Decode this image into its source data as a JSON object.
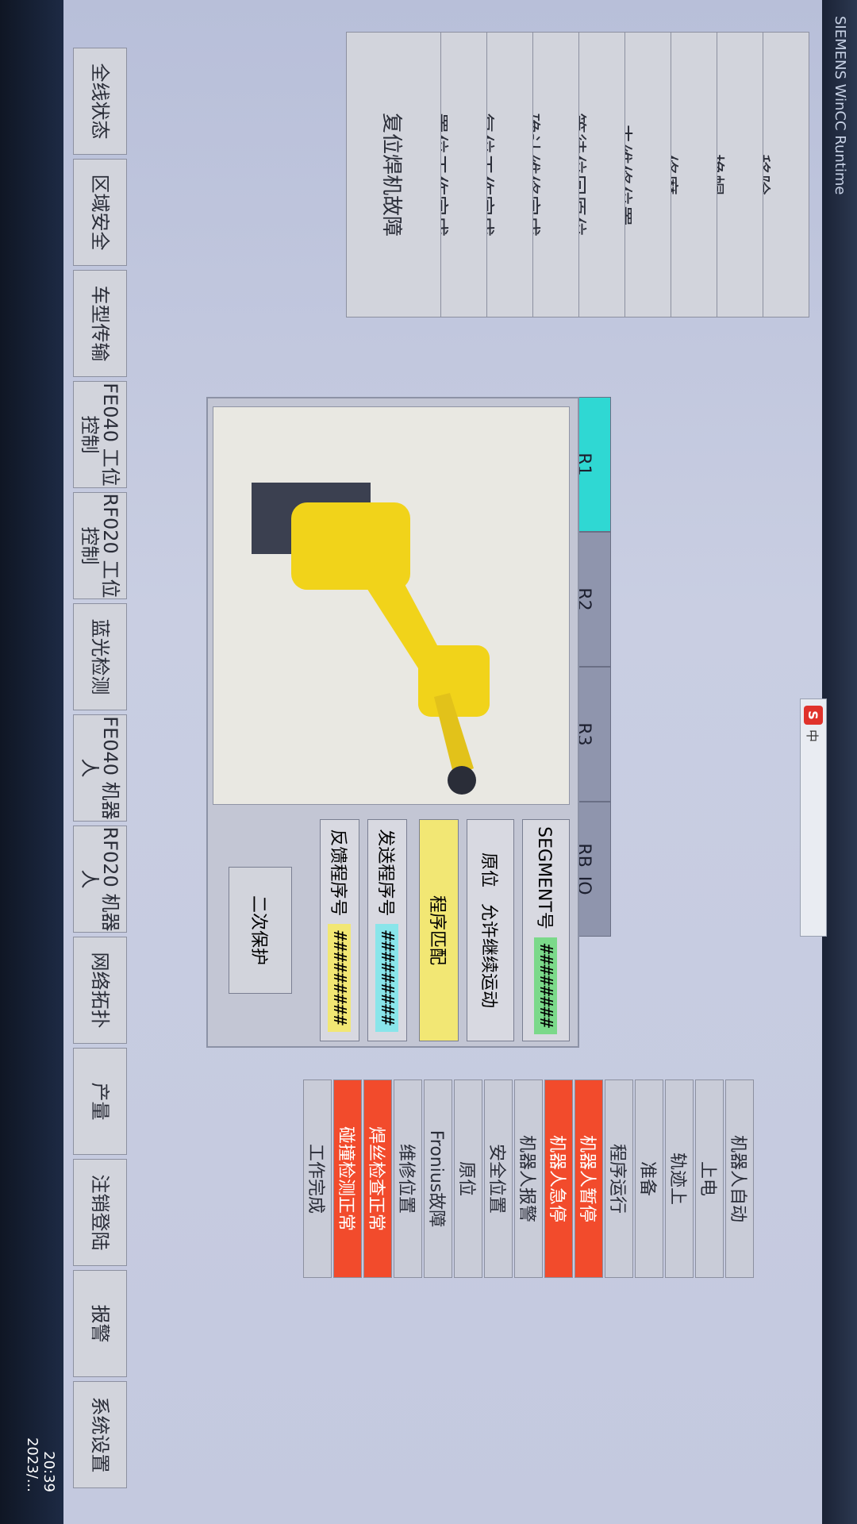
{
  "title": "SIEMENS WinCC Runtime",
  "ime": {
    "logo": "S",
    "label": "中"
  },
  "clock": {
    "time": "20:39",
    "date": "2023/..."
  },
  "left_menu": [
    "移除",
    "换帽",
    "修磨",
    "去维修位置",
    "等待位回原位",
    "确认维修完成",
    "复位工作完成",
    "置位工作完成",
    "复位焊机故障"
  ],
  "robot_tabs": [
    {
      "label": "R1",
      "active": true
    },
    {
      "label": "R2",
      "active": false
    },
    {
      "label": "R3",
      "active": false
    },
    {
      "label": "RB_IO",
      "active": false
    }
  ],
  "info": {
    "segment_label": "SEGMENT号",
    "segment_value": "########",
    "home_label": "原位",
    "allow_continue": "允许继续运动",
    "program_match": "程序匹配",
    "send_prog_label": "发送程序号",
    "send_prog_value": "#########",
    "feedback_prog_label": "反馈程序号",
    "feedback_prog_value": "#########",
    "secondary_protect": "二次保护"
  },
  "status_list": [
    {
      "label": "机器人自动",
      "alarm": false
    },
    {
      "label": "上电",
      "alarm": false
    },
    {
      "label": "轨迹上",
      "alarm": false
    },
    {
      "label": "准备",
      "alarm": false
    },
    {
      "label": "程序运行",
      "alarm": false
    },
    {
      "label": "机器人暂停",
      "alarm": true
    },
    {
      "label": "机器人急停",
      "alarm": true
    },
    {
      "label": "机器人报警",
      "alarm": false
    },
    {
      "label": "安全位置",
      "alarm": false
    },
    {
      "label": "原位",
      "alarm": false
    },
    {
      "label": "Fronius故障",
      "alarm": false
    },
    {
      "label": "维修位置",
      "alarm": false
    },
    {
      "label": "焊丝检查正常",
      "alarm": true
    },
    {
      "label": "碰撞检测正常",
      "alarm": true
    },
    {
      "label": "工作完成",
      "alarm": false
    }
  ],
  "bottom_nav": [
    "全线状态",
    "区域安全",
    "车型传输",
    "FE040 工位控制",
    "RF020 工位控制",
    "蓝光检测",
    "FE040 机器人",
    "RF020 机器人",
    "网络拓扑",
    "产量",
    "注销登陆",
    "报警",
    "系统设置"
  ],
  "colors": {
    "active_tab": "#2fd8d3",
    "alarm": "#f24b2c",
    "robot": "#f1d31a"
  }
}
